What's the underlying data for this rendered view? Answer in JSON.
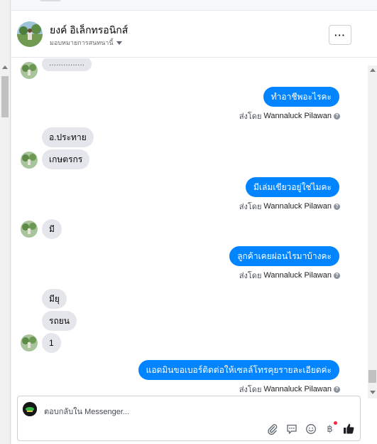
{
  "header": {
    "page_name": "ยงค์ อิเล็กทรอนิกส์",
    "assignee_label": "มอบหมายการสนทนานี้",
    "more_label": "···"
  },
  "thread": {
    "partial_top": "...............",
    "messages": [
      {
        "id": "out1",
        "dir": "out",
        "text": "ทำอาชีพอะไรคะ",
        "sent_by_prefix": "ส่งโดย",
        "sent_by_name": "Wannaluck Pilawan"
      },
      {
        "id": "in1",
        "dir": "in",
        "text": "อ.ประทาย"
      },
      {
        "id": "in2",
        "dir": "in",
        "text": "เกษตรกร"
      },
      {
        "id": "out2",
        "dir": "out",
        "text": "มีเล่มเขียวอยู่ใช่ไมคะ",
        "sent_by_prefix": "ส่งโดย",
        "sent_by_name": "Wannaluck Pilawan"
      },
      {
        "id": "in3",
        "dir": "in",
        "text": "มี"
      },
      {
        "id": "out3",
        "dir": "out",
        "text": "ลูกค้าเคยผ่อนไรมาบ้างคะ",
        "sent_by_prefix": "ส่งโดย",
        "sent_by_name": "Wannaluck Pilawan"
      },
      {
        "id": "in4",
        "dir": "in",
        "text": "มียุ"
      },
      {
        "id": "in5",
        "dir": "in",
        "text": "รถยน"
      },
      {
        "id": "in6",
        "dir": "in",
        "text": "1"
      },
      {
        "id": "out4",
        "dir": "out",
        "text": "แอดมินขอเบอร์ติดต่อให้เซลล์โทรคุยรายละเอียดค่ะ",
        "sent_by_prefix": "ส่งโดย",
        "sent_by_name": "Wannaluck Pilawan"
      }
    ]
  },
  "composer": {
    "placeholder": "ตอบกลับใน Messenger...",
    "tools": [
      "paperclip-icon",
      "message-icon",
      "emoji-icon",
      "baht-icon",
      "thumbs-up-icon"
    ],
    "baht_glyph": "฿"
  },
  "colors": {
    "outgoing_bubble": "#0084ff",
    "incoming_bubble": "#e4e6eb",
    "like_icon": "#1c1e21",
    "notification_dot": "#f02849"
  }
}
